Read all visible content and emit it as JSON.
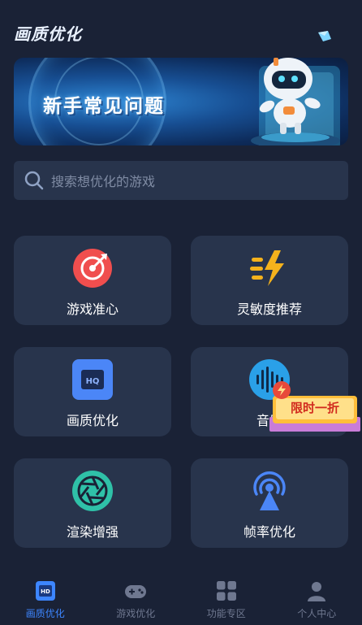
{
  "header": {
    "title": "画质优化"
  },
  "banner": {
    "title": "新手常见问题"
  },
  "search": {
    "placeholder": "搜索想优化的游戏"
  },
  "features": [
    {
      "label": "游戏准心",
      "icon": "target-arrow-icon",
      "color": "#f04e4e"
    },
    {
      "label": "灵敏度推荐",
      "icon": "speed-bolt-icon",
      "color": "#f5b21c"
    },
    {
      "label": "画质优化",
      "icon": "hq-icon",
      "color": "#4b86f7"
    },
    {
      "label": "音质",
      "icon": "sound-wave-icon",
      "color": "#2aa0e8"
    },
    {
      "label": "渲染增强",
      "icon": "aperture-icon",
      "color": "#2fc1a8"
    },
    {
      "label": "帧率优化",
      "icon": "broadcast-tower-icon",
      "color": "#4b86f7"
    }
  ],
  "promo": {
    "label": "限时一折"
  },
  "nav": [
    {
      "label": "画质优化",
      "icon": "hq-icon",
      "active": true
    },
    {
      "label": "游戏优化",
      "icon": "gamepad-icon",
      "active": false
    },
    {
      "label": "功能专区",
      "icon": "grid-icon",
      "active": false
    },
    {
      "label": "个人中心",
      "icon": "user-icon",
      "active": false
    }
  ],
  "colors": {
    "background": "#1a2236",
    "card": "#28344c",
    "accent": "#3d86ff",
    "nav_inactive": "#6f7890"
  }
}
